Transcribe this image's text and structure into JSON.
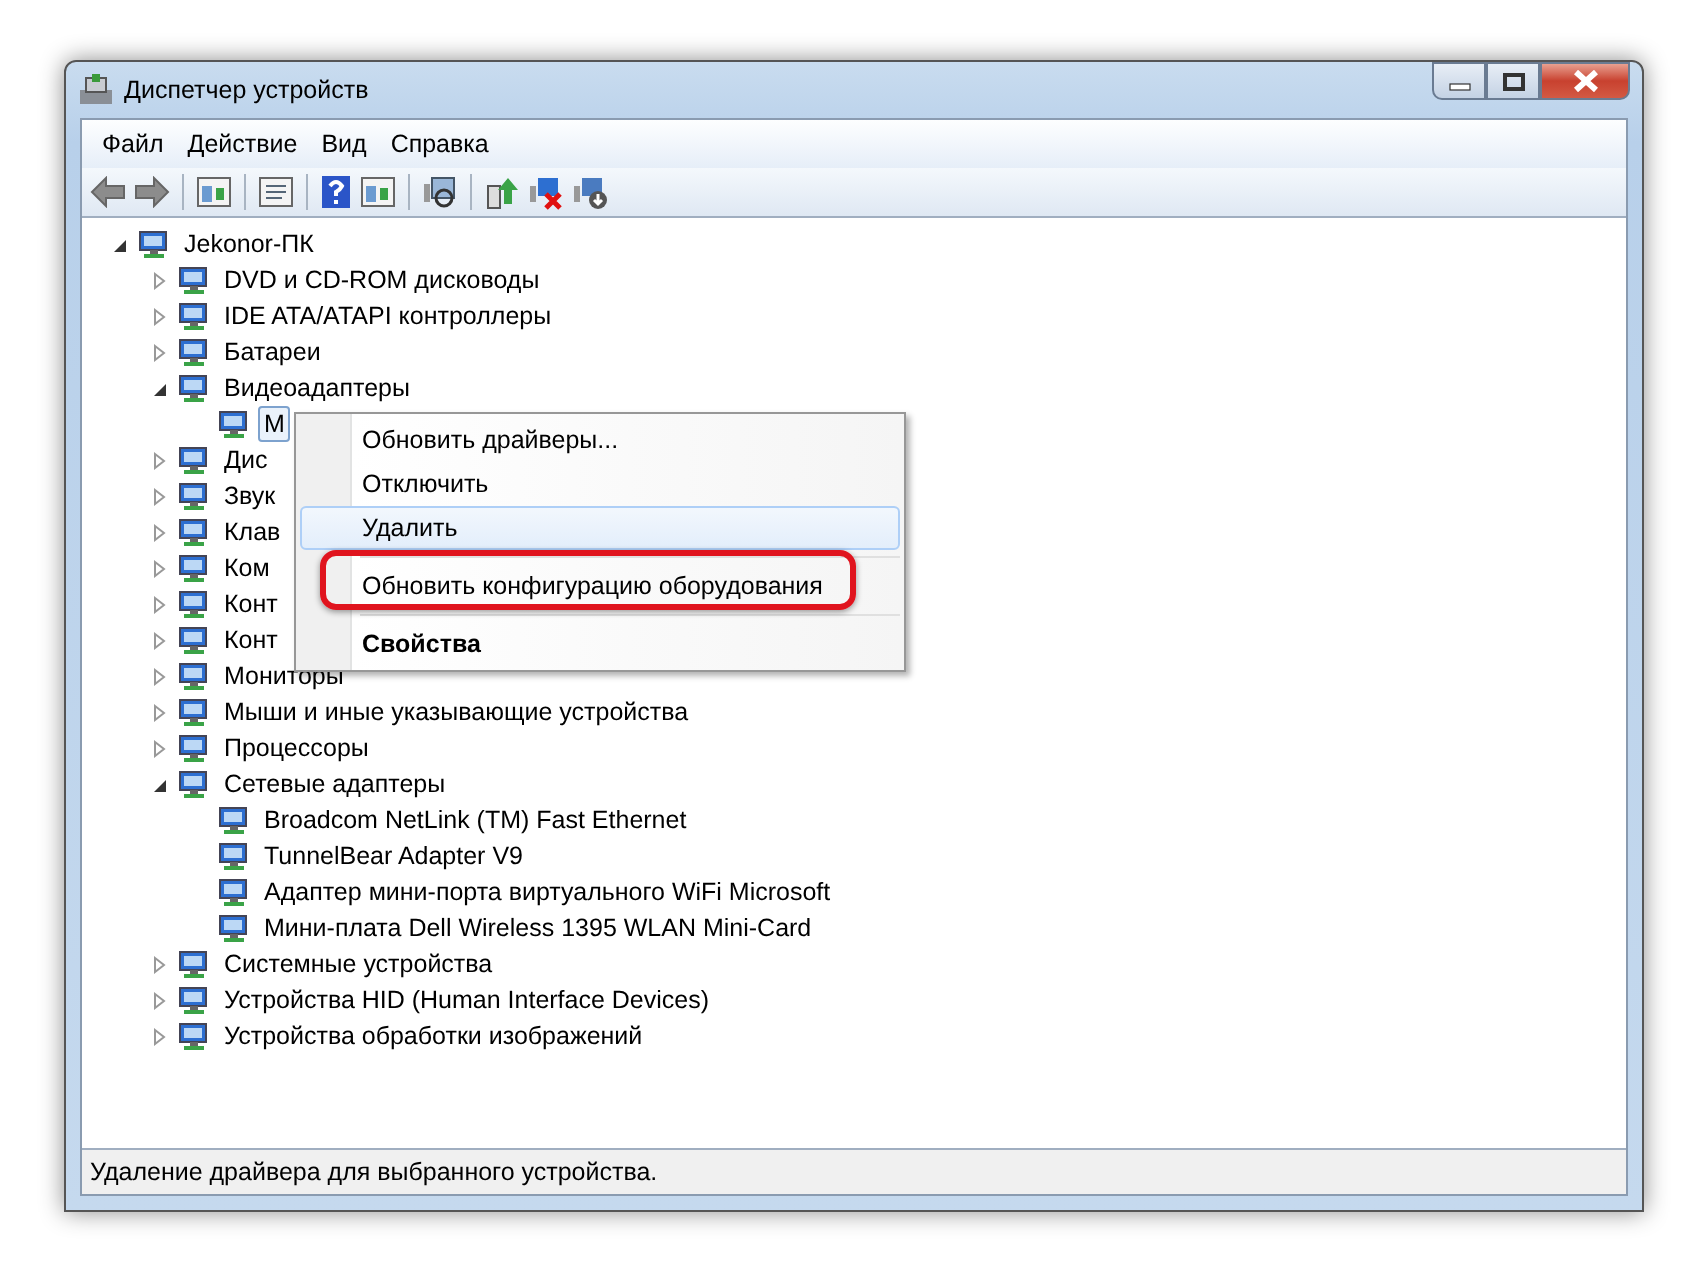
{
  "window": {
    "title": "Диспетчер устройств"
  },
  "menu_bar": [
    "Файл",
    "Действие",
    "Вид",
    "Справка"
  ],
  "tree": {
    "label": "Jekonor-ПК",
    "expanded": true,
    "selected": false,
    "children": [
      {
        "label": "DVD и CD-ROM дисководы",
        "expanded": false,
        "selected": false
      },
      {
        "label": "IDE ATA/ATAPI контроллеры",
        "expanded": false,
        "selected": false
      },
      {
        "label": "Батареи",
        "expanded": false,
        "selected": false
      },
      {
        "label": "Видеоадаптеры",
        "expanded": true,
        "selected": false,
        "children": [
          {
            "label": "M",
            "selected": true
          }
        ]
      },
      {
        "label": "Дис",
        "expanded": false,
        "selected": false
      },
      {
        "label": "Звук",
        "expanded": false,
        "selected": false
      },
      {
        "label": "Клав",
        "expanded": false,
        "selected": false
      },
      {
        "label": "Ком",
        "expanded": false,
        "selected": false
      },
      {
        "label": "Конт",
        "expanded": false,
        "selected": false
      },
      {
        "label": "Конт",
        "expanded": false,
        "selected": false
      },
      {
        "label": "Мониторы",
        "expanded": false,
        "selected": false
      },
      {
        "label": "Мыши и иные указывающие устройства",
        "expanded": false,
        "selected": false
      },
      {
        "label": "Процессоры",
        "expanded": false,
        "selected": false
      },
      {
        "label": "Сетевые адаптеры",
        "expanded": true,
        "selected": false,
        "children": [
          {
            "label": "Broadcom NetLink (TM) Fast Ethernet",
            "selected": false
          },
          {
            "label": "TunnelBear Adapter V9",
            "selected": false
          },
          {
            "label": "Адаптер мини-порта виртуального WiFi Microsoft",
            "selected": false
          },
          {
            "label": "Мини-плата Dell Wireless 1395 WLAN Mini-Card",
            "selected": false
          }
        ]
      },
      {
        "label": "Системные устройства",
        "expanded": false,
        "selected": false
      },
      {
        "label": "Устройства HID (Human Interface Devices)",
        "expanded": false,
        "selected": false
      },
      {
        "label": "Устройства обработки изображений",
        "expanded": false,
        "selected": false
      }
    ]
  },
  "context_menu": [
    {
      "kind": "item",
      "label": "Обновить драйверы...",
      "selected": false
    },
    {
      "kind": "item",
      "label": "Отключить",
      "selected": false
    },
    {
      "kind": "item",
      "label": "Удалить",
      "selected": true
    },
    {
      "kind": "separator"
    },
    {
      "kind": "item",
      "label": "Обновить конфигурацию оборудования",
      "selected": false,
      "circled": true
    },
    {
      "kind": "separator"
    },
    {
      "kind": "item",
      "label": "Свойства",
      "selected": false,
      "default": true
    }
  ],
  "status_bar": "Удаление драйвера для выбранного устройства."
}
